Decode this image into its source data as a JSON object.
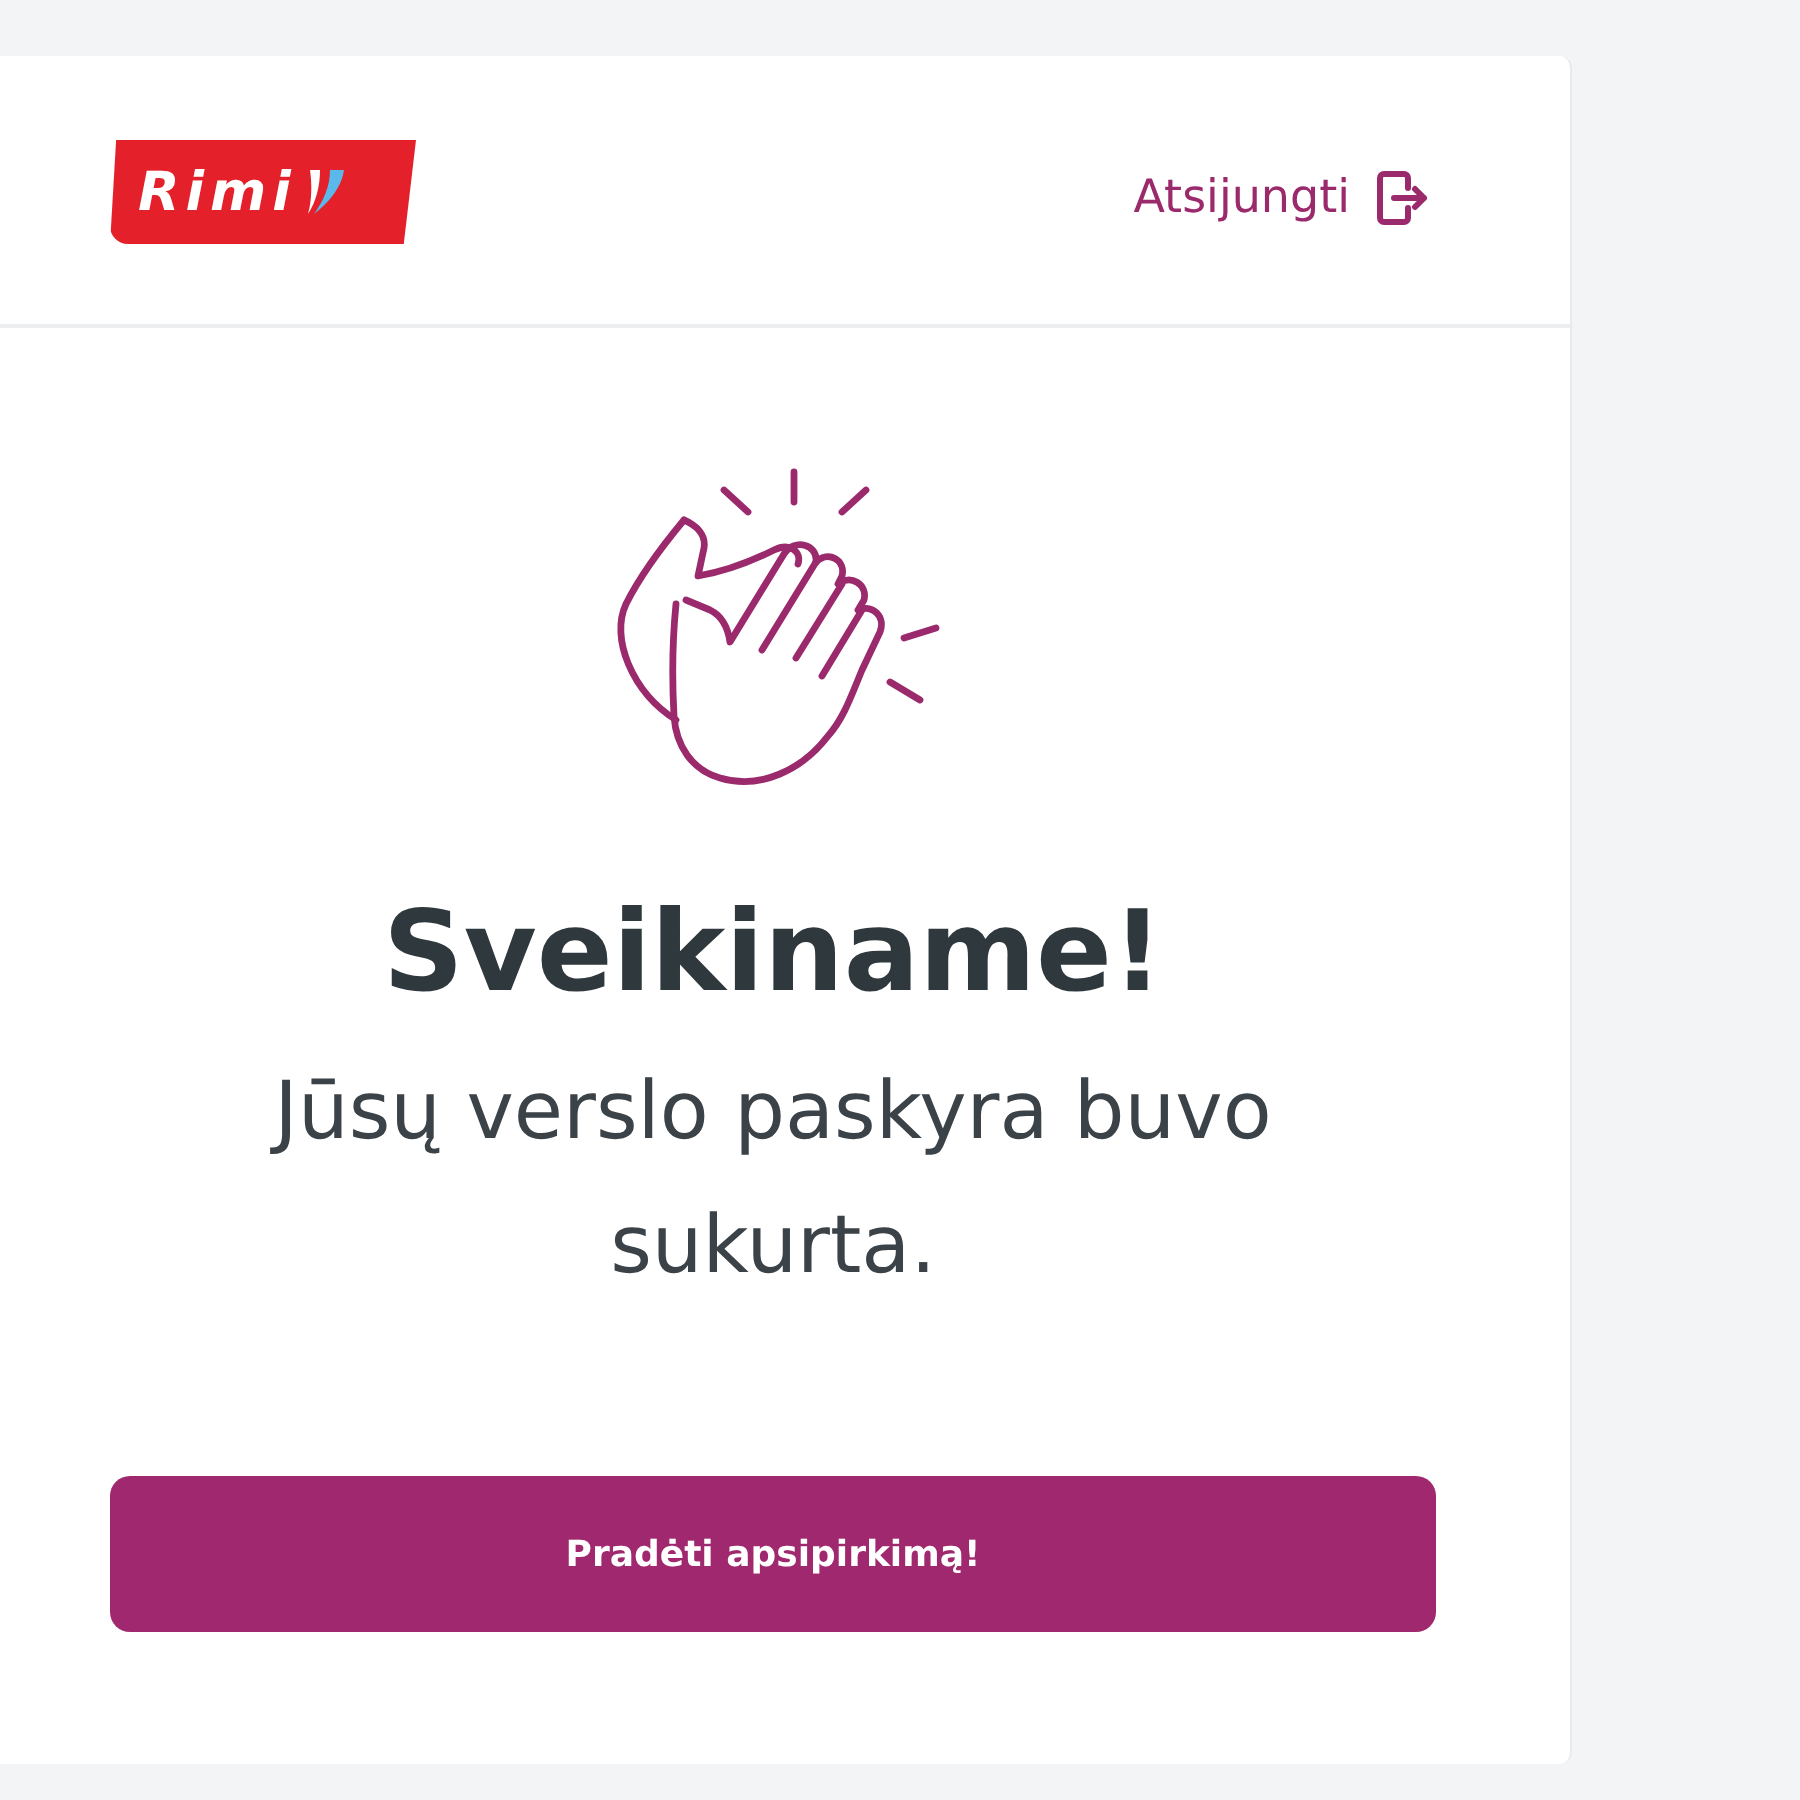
{
  "header": {
    "logo": {
      "text": "Rimi"
    },
    "logout": {
      "label": "Atsijungti"
    }
  },
  "success": {
    "title": "Sveikiname!",
    "message": "Jūsų verslo paskyra buvo sukurta."
  },
  "button": {
    "label": "Pradėti apsipirkimą!"
  }
}
